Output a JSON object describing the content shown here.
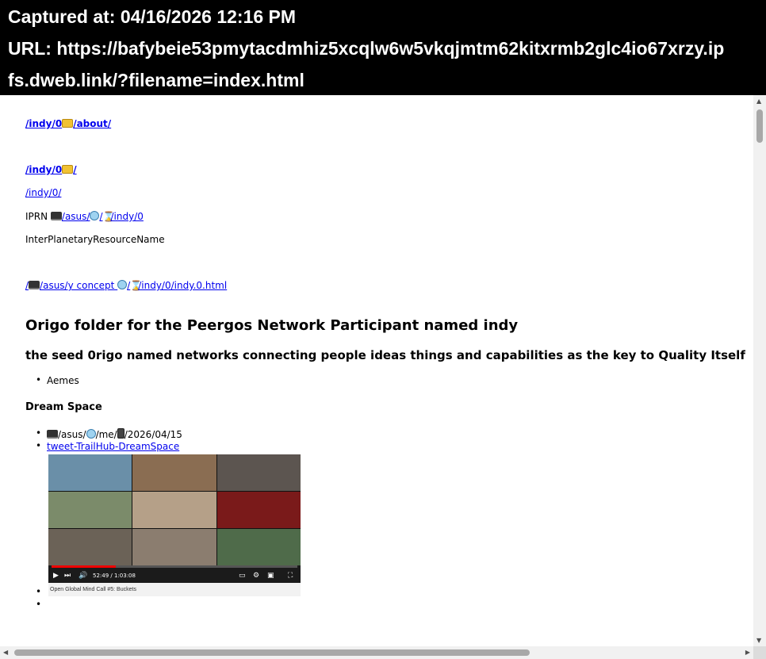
{
  "capture": {
    "line1": "Captured at: 04/16/2026 12:16 PM",
    "line2": "URL: https://bafybeie53pmytacdmhiz5xcqlw6w5vkqjmtm62kitxrmb2glc4io67xrzy.ip",
    "line3": "fs.dweb.link/?filename=index.html"
  },
  "links": {
    "about_a": "/indy/0",
    "about_b": "/about/",
    "root_a": "/indy/0",
    "root_b": "/",
    "indy0": "/indy/0/",
    "iprn_label": "IPRN ",
    "iprn_a": "/asus/",
    "iprn_b": "/",
    "iprn_c": "/indy/0",
    "iprn_full": "InterPlanetaryResourceName",
    "concept_a": "/",
    "concept_b": "/asus/y concept ",
    "concept_c": "/",
    "concept_d": "/indy/0/indy.0.html"
  },
  "heading": {
    "title": "Origo folder for the Peergos Network Participant named indy",
    "subtitle": "the seed 0rigo named networks connecting people ideas things and  capabilities as the key to Quality Itself"
  },
  "list1": [
    "Aemes"
  ],
  "dream": {
    "title": "Dream Space",
    "path_a": "/asus/",
    "path_b": "/me/",
    "path_c": "/2026/04/15",
    "tweet_link": "tweet-TrailHub-DreamSpace",
    "video_time": "52:49 / 1:03:08",
    "caption": "Open Global Mind Call #5: Buckets"
  },
  "icons": [
    "folder-icon",
    "laptop-icon",
    "globe-icon",
    "hourglass-icon",
    "phone-icon"
  ]
}
